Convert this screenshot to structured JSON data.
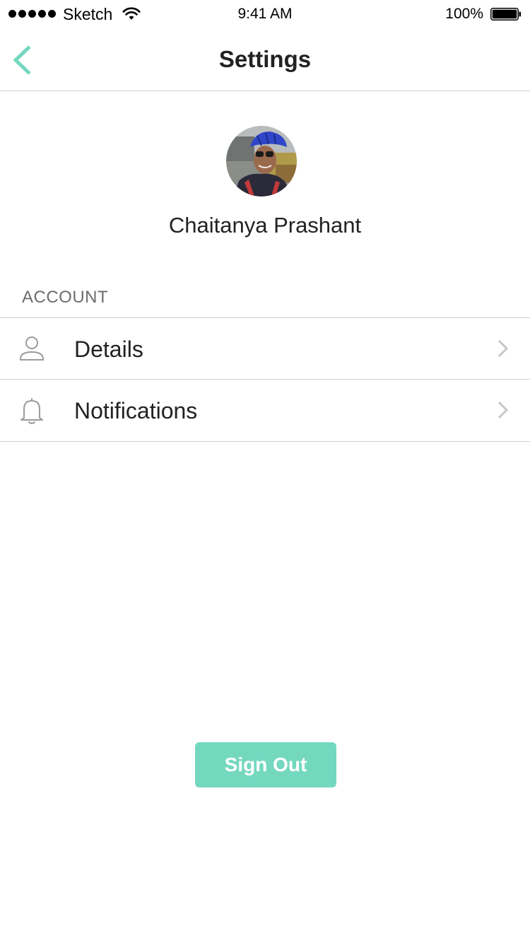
{
  "status_bar": {
    "carrier": "Sketch",
    "time": "9:41 AM",
    "battery_percent": "100%",
    "battery_level": 1.0
  },
  "nav": {
    "title": "Settings",
    "back_icon": "chevron-left-icon",
    "accent_color": "#74d8bf"
  },
  "profile": {
    "name": "Chaitanya Prashant"
  },
  "account_section": {
    "header": "ACCOUNT",
    "items": [
      {
        "label": "Details",
        "icon": "person-icon"
      },
      {
        "label": "Notifications",
        "icon": "bell-icon"
      }
    ]
  },
  "actions": {
    "sign_out_label": "Sign Out",
    "sign_out_color": "#74d8bf"
  }
}
